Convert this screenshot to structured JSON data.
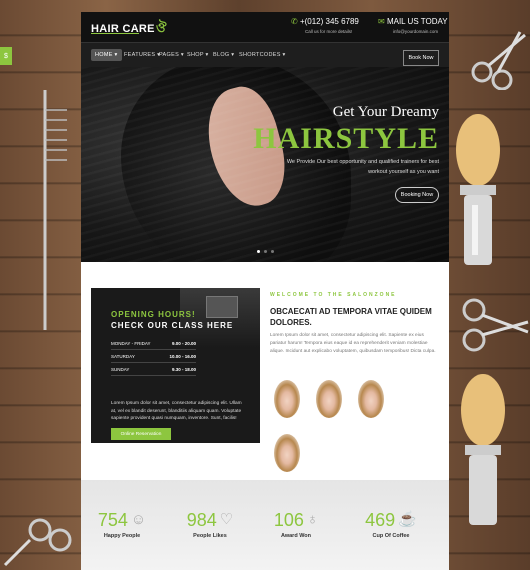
{
  "colors": {
    "accent": "#8dc63f",
    "dark": "#111111"
  },
  "side_tab": {
    "label": "$"
  },
  "header": {
    "logo": "HAIR CARE",
    "phone": "+(012) 345 6789",
    "phone_sub": "Call us for more details!",
    "mail": "MAIL US TODAY",
    "mail_sub": "info@yourdomain.com",
    "phone_icon": "phone-icon",
    "mail_icon": "envelope-icon"
  },
  "nav": {
    "items": [
      {
        "label": "HOME ▾"
      },
      {
        "label": "FEATURES ▾"
      },
      {
        "label": "PAGES ▾"
      },
      {
        "label": "SHOP ▾"
      },
      {
        "label": "BLOG ▾"
      },
      {
        "label": "SHORTCODES ▾"
      }
    ],
    "book_label": "Book Now"
  },
  "hero": {
    "subtitle": "Get Your Dreamy",
    "title": "HAIRSTYLE",
    "text": "We Provide Our best opportunity and qualified trainers for best workout yourself as you want",
    "button": "Booking Now",
    "slides": 3,
    "active_slide": 1
  },
  "hours": {
    "title": "OPENING HOURS!",
    "subtitle": "CHECK OUR CLASS HERE",
    "rows": [
      {
        "day": "MONDAY - FRIDAY",
        "time": "9.00 - 20.00"
      },
      {
        "day": "SATURDAY",
        "time": "10.00 - 16.00"
      },
      {
        "day": "SUNDAY",
        "time": "9.30 - 18.00"
      }
    ],
    "text": "Lorem Ipsum dolor sit amet, consectetur adipiscing elit. Ullam at, vel ex blandit deserunt, blanditiis aliquam quam. Voluptate sapiente provident quasi numquam, inventore. Sunt, facilis!",
    "button": "Online Reservation"
  },
  "welcome": {
    "label": "WELCOME TO THE SALONZONE",
    "title": "OBCAECATI AD TEMPORA VITAE QUIDEM DOLORES.",
    "text": "Lorem Ipsum dolor sit amet, consectetur adipiscing elit. Sapiente ex eius pariatur harum! Tempora eius eaque id ea reprehenderit veniam molestiae alique. Incidunt aut explicabo voluptatem, quibusdam temporibus! Dicta culpa."
  },
  "stats": [
    {
      "num": "754",
      "label": "Happy People",
      "icon": "smiley-icon",
      "glyph": "☺"
    },
    {
      "num": "984",
      "label": "People Likes",
      "icon": "heart-icon",
      "glyph": "♡"
    },
    {
      "num": "106",
      "label": "Award Won",
      "icon": "medal-icon",
      "glyph": "♁"
    },
    {
      "num": "469",
      "label": "Cup Of Coffee",
      "icon": "coffee-cup-icon",
      "glyph": "☕"
    }
  ]
}
